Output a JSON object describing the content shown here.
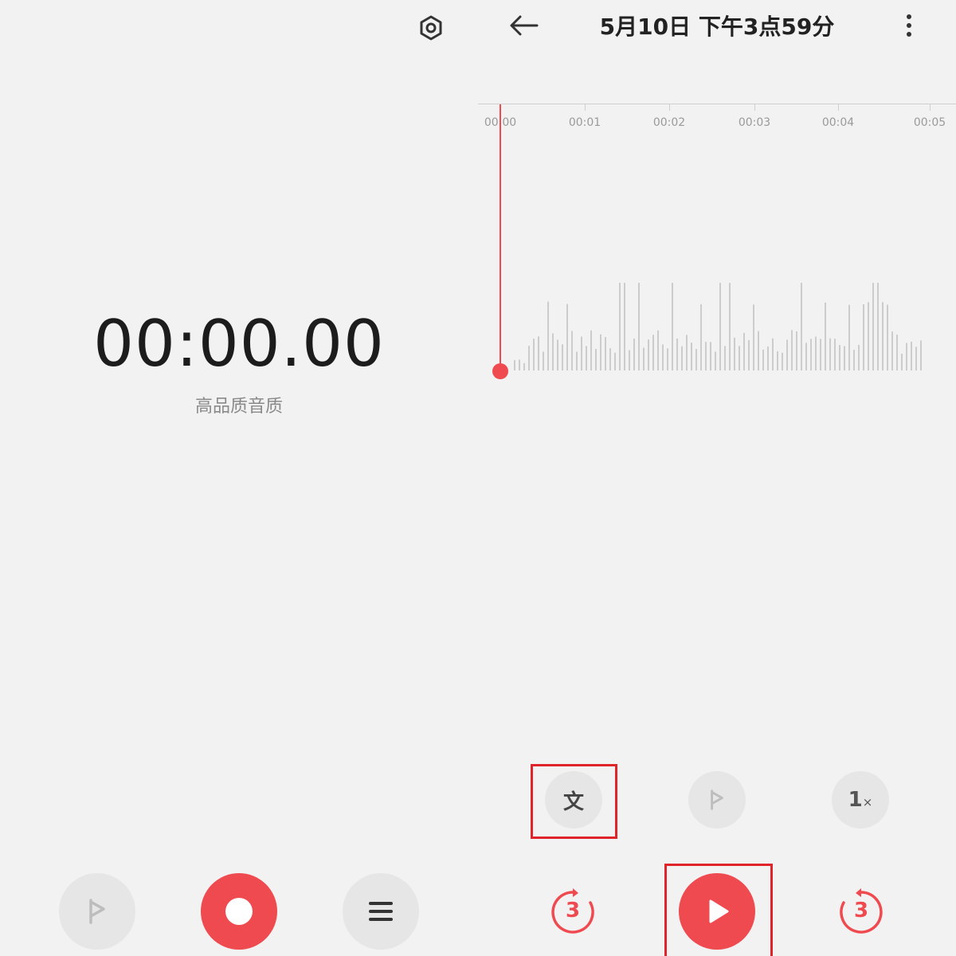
{
  "recorder": {
    "timer": "00:00.00",
    "quality": "高品质音质"
  },
  "playback": {
    "title": "5月10日 下午3点59分",
    "timeline_ticks": [
      "00:00",
      "00:01",
      "00:02",
      "00:03",
      "00:04",
      "00:05"
    ],
    "transcribe_label": "文",
    "speed_label": "1",
    "speed_suffix": "×",
    "skip_back_seconds": "3",
    "skip_forward_seconds": "3",
    "playhead_position": "00:00"
  },
  "colors": {
    "accent": "#ef4a4f",
    "highlight": "#e0242b",
    "button_gray": "#e6e6e6",
    "background": "#f2f2f2"
  },
  "icons": {
    "settings": "gear-icon",
    "back": "arrow-left-icon",
    "more": "more-vertical-icon",
    "flag": "flag-icon",
    "record": "record-icon",
    "list": "list-icon",
    "transcribe": "text-icon",
    "play": "play-icon",
    "rewind": "rewind-3s-icon",
    "forward": "forward-3s-icon"
  }
}
